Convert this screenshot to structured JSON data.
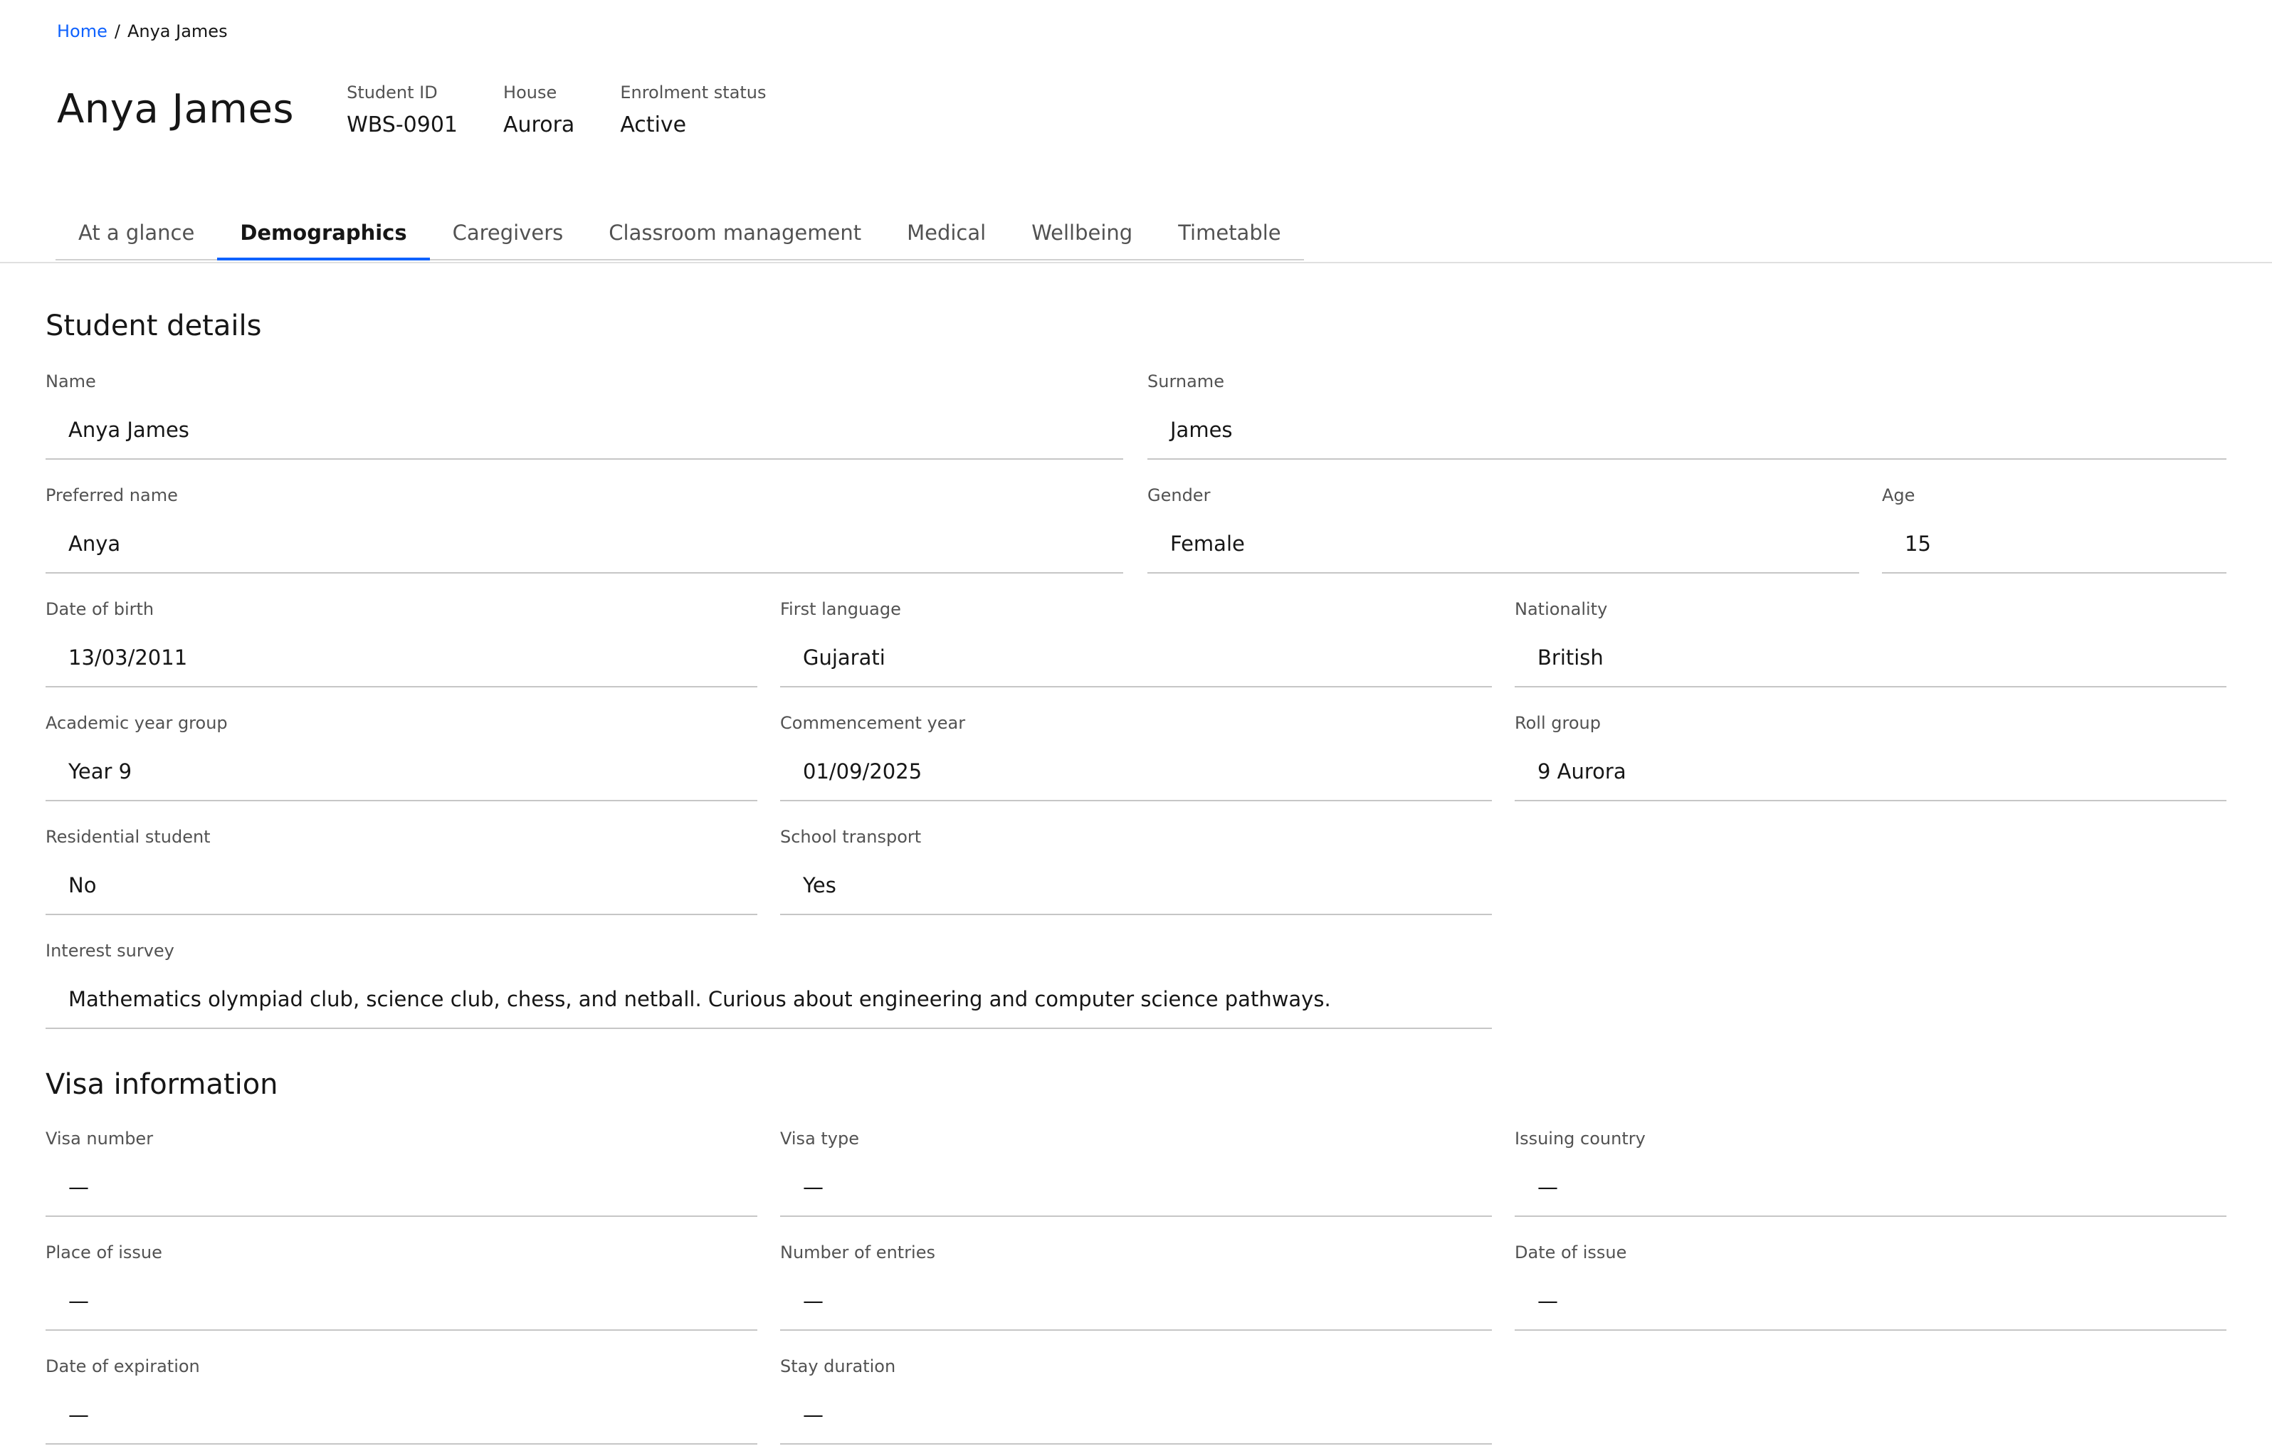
{
  "breadcrumb": {
    "home": "Home",
    "separator": "/",
    "current": "Anya James"
  },
  "header": {
    "title": "Anya James",
    "meta": [
      {
        "label": "Student ID",
        "value": "WBS-0901"
      },
      {
        "label": "House",
        "value": "Aurora"
      },
      {
        "label": "Enrolment status",
        "value": "Active"
      }
    ]
  },
  "tabs": [
    {
      "label": "At a glance"
    },
    {
      "label": "Demographics",
      "active": true
    },
    {
      "label": "Caregivers"
    },
    {
      "label": "Classroom management"
    },
    {
      "label": "Medical"
    },
    {
      "label": "Wellbeing"
    },
    {
      "label": "Timetable"
    }
  ],
  "student": {
    "title": "Student details",
    "name": {
      "label": "Name",
      "value": "Anya James"
    },
    "surname": {
      "label": "Surname",
      "value": "James"
    },
    "preferred": {
      "label": "Preferred name",
      "value": "Anya"
    },
    "gender": {
      "label": "Gender",
      "value": "Female"
    },
    "age": {
      "label": "Age",
      "value": "15"
    },
    "dob": {
      "label": "Date of birth",
      "value": "13/03/2011"
    },
    "language": {
      "label": "First language",
      "value": "Gujarati"
    },
    "nationality": {
      "label": "Nationality",
      "value": "British"
    },
    "year_group": {
      "label": "Academic year group",
      "value": "Year 9"
    },
    "commencement": {
      "label": "Commencement year",
      "value": "01/09/2025"
    },
    "roll_group": {
      "label": "Roll group",
      "value": "9 Aurora"
    },
    "residential": {
      "label": "Residential student",
      "value": "No"
    },
    "transport": {
      "label": "School transport",
      "value": "Yes"
    },
    "interest": {
      "label": "Interest survey",
      "value": "Mathematics olympiad club, science club, chess, and netball. Curious about engineering and computer science pathways."
    }
  },
  "visa": {
    "title": "Visa information",
    "number": {
      "label": "Visa number",
      "value": "—"
    },
    "type": {
      "label": "Visa type",
      "value": "—"
    },
    "country": {
      "label": "Issuing country",
      "value": "—"
    },
    "place": {
      "label": "Place of issue",
      "value": "—"
    },
    "entries": {
      "label": "Number of entries",
      "value": "—"
    },
    "issue_date": {
      "label": "Date of issue",
      "value": "—"
    },
    "expiration": {
      "label": "Date of expiration",
      "value": "—"
    },
    "stay": {
      "label": "Stay duration",
      "value": "—"
    }
  }
}
